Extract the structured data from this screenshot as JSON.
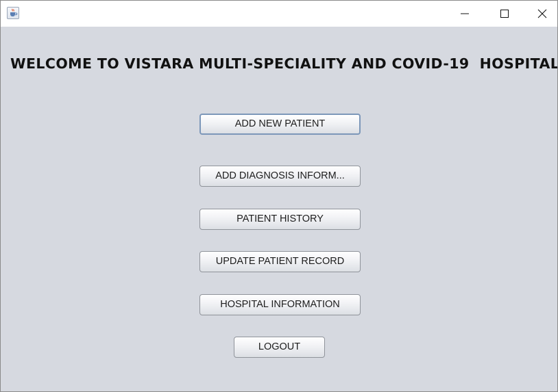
{
  "window": {
    "app_icon": "java-cup-icon",
    "controls": {
      "minimize": "minimize-icon",
      "maximize": "maximize-icon",
      "close": "close-icon"
    }
  },
  "main": {
    "heading": "WELCOME TO VISTARA MULTI-SPECIALITY AND COVID-19  HOSPITAL",
    "buttons": {
      "add_new_patient": "ADD NEW PATIENT",
      "add_diagnosis": "ADD DIAGNOSIS INFORM...",
      "patient_history": "PATIENT HISTORY",
      "update_patient_record": "UPDATE PATIENT RECORD",
      "hospital_information": "HOSPITAL INFORMATION",
      "logout": "LOGOUT"
    }
  },
  "colors": {
    "background": "#d6d9e0",
    "focus_border": "#7c97b9"
  }
}
